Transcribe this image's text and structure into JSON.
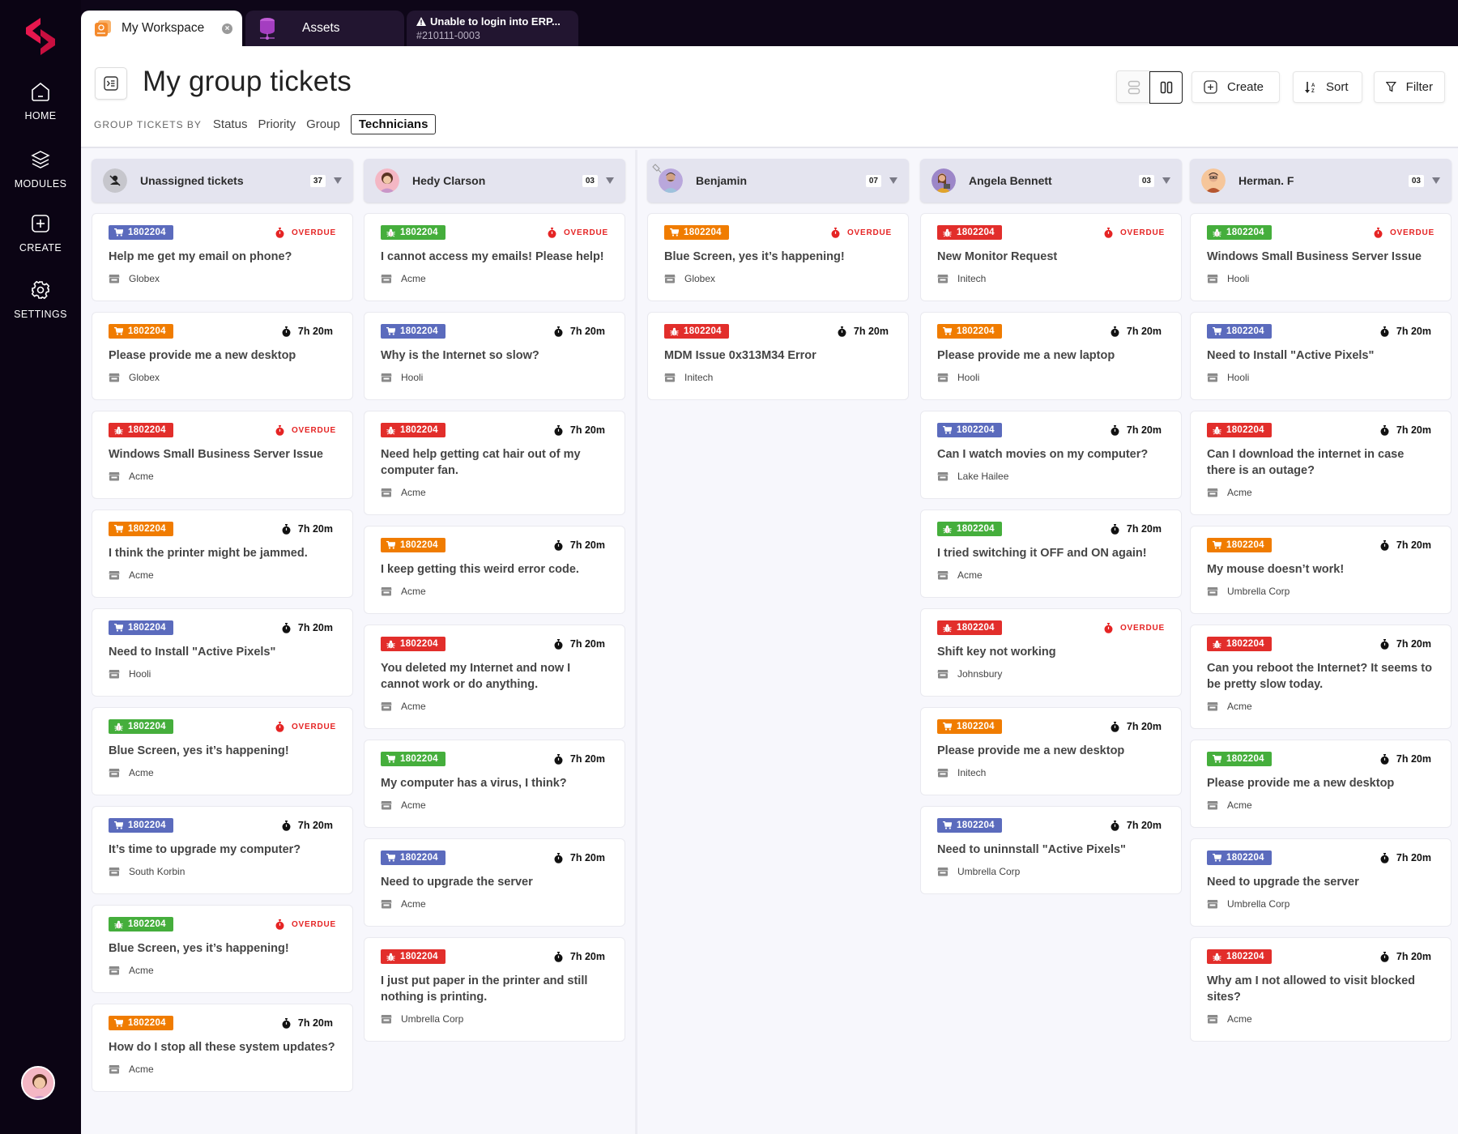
{
  "sidebar": {
    "items": [
      {
        "label": "HOME",
        "icon": "home-icon"
      },
      {
        "label": "MODULES",
        "icon": "layers-icon"
      },
      {
        "label": "CREATE",
        "icon": "plus-square-icon"
      },
      {
        "label": "SETTINGS",
        "icon": "gear-icon"
      }
    ]
  },
  "tabs": [
    {
      "label": "My Workspace",
      "icon": "workspace-icon",
      "active": true
    },
    {
      "label": "Assets",
      "icon": "database-icon"
    },
    {
      "label": "Unable to login into ERP...",
      "sub": "#210111-0003",
      "icon": "warning-icon"
    }
  ],
  "header": {
    "title": "My group tickets",
    "group_by_label": "GROUP TICKETS BY",
    "group_by_options": [
      "Status",
      "Priority",
      "Group",
      "Technicians"
    ],
    "group_by_selected": "Technicians",
    "create_label": "Create",
    "sort_label": "Sort",
    "filter_label": "Filter"
  },
  "colors": {
    "blue": "#5b6bbd",
    "orange": "#f07c00",
    "green": "#45ae3c",
    "red": "#e22e2b",
    "overdue": "#e52424",
    "brand": "#e8174e"
  },
  "columns": [
    {
      "name": "Unassigned tickets",
      "count": "37",
      "avatar": "unassigned",
      "cards": [
        {
          "id": "1802204",
          "color": "blue",
          "icon": "cart",
          "status": "OVERDUE",
          "title": "Help me get my email on phone?",
          "org": "Globex"
        },
        {
          "id": "1802204",
          "color": "orange",
          "icon": "cart",
          "status": "7h 20m",
          "title": "Please provide me a new desktop",
          "org": "Globex"
        },
        {
          "id": "1802204",
          "color": "red",
          "icon": "bug",
          "status": "OVERDUE",
          "title": "Windows Small Business Server Issue",
          "org": "Acme"
        },
        {
          "id": "1802204",
          "color": "orange",
          "icon": "cart",
          "status": "7h 20m",
          "title": "I think the printer might be jammed.",
          "org": "Acme"
        },
        {
          "id": "1802204",
          "color": "blue",
          "icon": "cart",
          "status": "7h 20m",
          "title": "Need to Install \"Active Pixels\"",
          "org": "Hooli"
        },
        {
          "id": "1802204",
          "color": "green",
          "icon": "bug",
          "status": "OVERDUE",
          "title": "Blue Screen, yes it’s happening!",
          "org": "Acme"
        },
        {
          "id": "1802204",
          "color": "blue",
          "icon": "cart",
          "status": "7h 20m",
          "title": "It’s time to upgrade my computer?",
          "org": "South Korbin"
        },
        {
          "id": "1802204",
          "color": "green",
          "icon": "bug",
          "status": "OVERDUE",
          "title": "Blue Screen, yes it’s happening!",
          "org": "Acme"
        },
        {
          "id": "1802204",
          "color": "orange",
          "icon": "cart",
          "status": "7h 20m",
          "title": "How do I stop all these system updates?",
          "org": "Acme"
        }
      ]
    },
    {
      "name": "Hedy Clarson",
      "count": "03",
      "avatar": "hedy",
      "cards": [
        {
          "id": "1802204",
          "color": "green",
          "icon": "bug",
          "status": "OVERDUE",
          "title": "I cannot access my emails! Please help!",
          "org": "Acme"
        },
        {
          "id": "1802204",
          "color": "blue",
          "icon": "cart",
          "status": "7h 20m",
          "title": "Why is the Internet so slow?",
          "org": "Hooli"
        },
        {
          "id": "1802204",
          "color": "red",
          "icon": "bug",
          "status": "7h 20m",
          "title": "Need help getting cat hair out of my computer fan.",
          "org": "Acme"
        },
        {
          "id": "1802204",
          "color": "orange",
          "icon": "cart",
          "status": "7h 20m",
          "title": "I keep getting this weird error code.",
          "org": "Acme"
        },
        {
          "id": "1802204",
          "color": "red",
          "icon": "bug",
          "status": "7h 20m",
          "title": "You deleted my Internet and now I cannot work or do anything.",
          "org": "Acme"
        },
        {
          "id": "1802204",
          "color": "green",
          "icon": "cart",
          "status": "7h 20m",
          "title": "My computer has a virus, I think?",
          "org": "Acme"
        },
        {
          "id": "1802204",
          "color": "blue",
          "icon": "cart",
          "status": "7h 20m",
          "title": "Need to upgrade the server",
          "org": "Acme"
        },
        {
          "id": "1802204",
          "color": "red",
          "icon": "bug",
          "status": "7h 20m",
          "title": "I just put paper in the printer and still nothing is printing.",
          "org": "Umbrella Corp"
        }
      ]
    },
    {
      "name": "Benjamin",
      "count": "07",
      "avatar": "benjamin",
      "pinned": true,
      "cards": [
        {
          "id": "1802204",
          "color": "orange",
          "icon": "cart",
          "status": "OVERDUE",
          "title": "Blue Screen, yes it’s happening!",
          "org": "Globex"
        },
        {
          "id": "1802204",
          "color": "red",
          "icon": "bug",
          "status": "7h 20m",
          "title": "MDM Issue 0x313M34 Error",
          "org": "Initech"
        }
      ]
    },
    {
      "name": "Angela Bennett",
      "count": "03",
      "avatar": "angela",
      "cards": [
        {
          "id": "1802204",
          "color": "red",
          "icon": "bug",
          "status": "OVERDUE",
          "title": "New Monitor Request",
          "org": "Initech"
        },
        {
          "id": "1802204",
          "color": "orange",
          "icon": "cart",
          "status": "7h 20m",
          "title": "Please provide me a new laptop",
          "org": "Hooli"
        },
        {
          "id": "1802204",
          "color": "blue",
          "icon": "cart",
          "status": "7h 20m",
          "title": "Can I watch movies on my computer?",
          "org": "Lake Hailee"
        },
        {
          "id": "1802204",
          "color": "green",
          "icon": "bug",
          "status": "7h 20m",
          "title": "I tried switching it OFF and ON again!",
          "org": "Acme"
        },
        {
          "id": "1802204",
          "color": "red",
          "icon": "bug",
          "status": "OVERDUE",
          "title": "Shift key not working",
          "org": "Johnsbury"
        },
        {
          "id": "1802204",
          "color": "orange",
          "icon": "cart",
          "status": "7h 20m",
          "title": "Please provide me a new desktop",
          "org": "Initech"
        },
        {
          "id": "1802204",
          "color": "blue",
          "icon": "cart",
          "status": "7h 20m",
          "title": "Need to uninnstall \"Active Pixels\"",
          "org": "Umbrella Corp"
        }
      ]
    },
    {
      "name": "Herman. F",
      "count": "03",
      "avatar": "herman",
      "cards": [
        {
          "id": "1802204",
          "color": "green",
          "icon": "bug",
          "status": "OVERDUE",
          "title": "Windows Small Business Server Issue",
          "org": "Hooli"
        },
        {
          "id": "1802204",
          "color": "blue",
          "icon": "cart",
          "status": "7h 20m",
          "title": "Need to Install \"Active Pixels\"",
          "org": "Hooli"
        },
        {
          "id": "1802204",
          "color": "red",
          "icon": "bug",
          "status": "7h 20m",
          "title": "Can I download the internet in case there is an outage?",
          "org": "Acme"
        },
        {
          "id": "1802204",
          "color": "orange",
          "icon": "cart",
          "status": "7h 20m",
          "title": "My mouse doesn’t work!",
          "org": "Umbrella Corp"
        },
        {
          "id": "1802204",
          "color": "red",
          "icon": "bug",
          "status": "7h 20m",
          "title": "Can you reboot the Internet? It seems to be pretty slow today.",
          "org": "Acme"
        },
        {
          "id": "1802204",
          "color": "green",
          "icon": "cart",
          "status": "7h 20m",
          "title": "Please provide me a new desktop",
          "org": "Acme"
        },
        {
          "id": "1802204",
          "color": "blue",
          "icon": "cart",
          "status": "7h 20m",
          "title": "Need to upgrade the server",
          "org": "Umbrella Corp"
        },
        {
          "id": "1802204",
          "color": "red",
          "icon": "bug",
          "status": "7h 20m",
          "title": "Why am I not allowed to visit blocked sites?",
          "org": "Acme"
        }
      ]
    }
  ]
}
